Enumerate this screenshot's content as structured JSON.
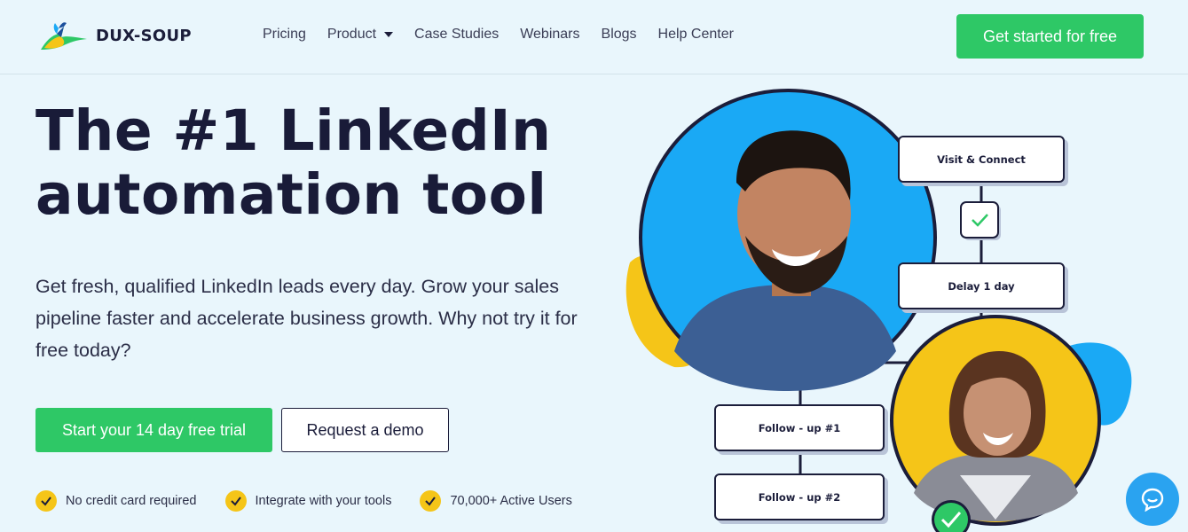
{
  "brand": {
    "name": "DUX-SOUP",
    "accent": "#2ec866",
    "yellow": "#f5c518",
    "blue": "#1aa9f5"
  },
  "nav": {
    "items": [
      {
        "label": "Pricing"
      },
      {
        "label": "Product"
      },
      {
        "label": "Case Studies"
      },
      {
        "label": "Webinars"
      },
      {
        "label": "Blogs"
      },
      {
        "label": "Help Center"
      }
    ],
    "cta": "Get started for free"
  },
  "hero": {
    "title_line1": "The #1 LinkedIn",
    "title_line2": "automation tool",
    "subtitle": "Get fresh, qualified LinkedIn leads every day. Grow your sales pipeline faster and accelerate business growth. Why not try it for free today?",
    "primary_button": "Start your 14 day free trial",
    "secondary_button": "Request a demo"
  },
  "features": [
    {
      "label": "No credit card required",
      "icon": "check-icon"
    },
    {
      "label": "Integrate with your tools",
      "icon": "check-icon"
    },
    {
      "label": "70,000+ Active Users",
      "icon": "check-icon"
    }
  ],
  "workflow": {
    "steps": [
      "Visit & Connect",
      "Delay 1 day",
      "Follow - up #1",
      "Follow - up #2"
    ]
  },
  "chat": {
    "icon": "chat-icon"
  }
}
